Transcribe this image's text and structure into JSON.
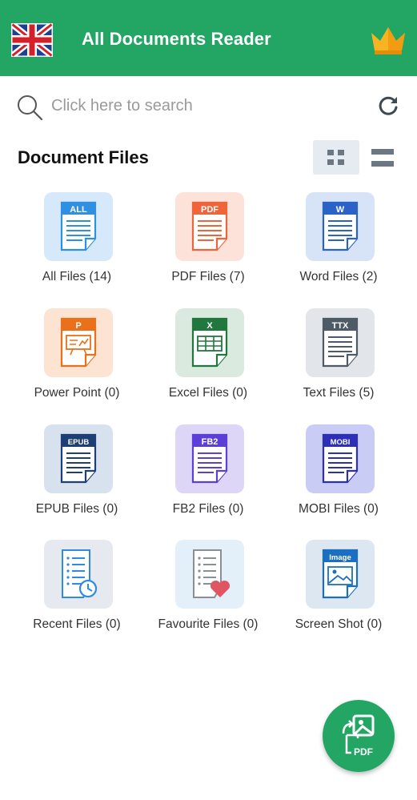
{
  "header": {
    "title": "All Documents Reader",
    "flag_icon": "uk-flag-icon",
    "premium_icon": "crown-icon",
    "color": "#23a564"
  },
  "search": {
    "placeholder": "Click here to search",
    "value": "",
    "refresh_icon": "refresh-icon"
  },
  "section": {
    "title": "Document Files",
    "view_modes": [
      "grid",
      "list"
    ],
    "active_view": "grid"
  },
  "tiles": [
    {
      "label": "All Files (14)",
      "badge": "ALL",
      "icon": "all-files-icon",
      "accent": "#2f8fe0",
      "bg": "#d6e9fb"
    },
    {
      "label": "PDF Files (7)",
      "badge": "PDF",
      "icon": "pdf-icon",
      "accent": "#f0643a",
      "bg": "#fde2da"
    },
    {
      "label": "Word Files (2)",
      "badge": "W",
      "icon": "word-icon",
      "accent": "#2a62c8",
      "bg": "#d7e4f7"
    },
    {
      "label": "Power Point (0)",
      "badge": "P",
      "icon": "powerpoint-icon",
      "accent": "#ea7019",
      "bg": "#fde3d2"
    },
    {
      "label": "Excel Files (0)",
      "badge": "X",
      "icon": "excel-icon",
      "accent": "#21783e",
      "bg": "#dbeadf"
    },
    {
      "label": "Text Files (5)",
      "badge": "TTX",
      "icon": "text-file-icon",
      "accent": "#4f5a67",
      "bg": "#e2e5ea"
    },
    {
      "label": "EPUB Files (0)",
      "badge": "EPUB",
      "icon": "epub-icon",
      "accent": "#1e3f73",
      "bg": "#d8e2ef"
    },
    {
      "label": "FB2 Files (0)",
      "badge": "FB2",
      "icon": "fb2-icon",
      "accent": "#5b3fd6",
      "bg": "#ddd6f6"
    },
    {
      "label": "MOBI Files (0)",
      "badge": "MOBI",
      "icon": "mobi-icon",
      "accent": "#2d2fb6",
      "bg": "#c9cdf5"
    },
    {
      "label": "Recent Files (0)",
      "badge": "",
      "icon": "recent-files-icon",
      "accent": "#2d8be3",
      "bg": "#e6e9ef"
    },
    {
      "label": "Favourite Files (0)",
      "badge": "",
      "icon": "favourite-files-icon",
      "accent": "#e05561",
      "bg": "#e3f0fa"
    },
    {
      "label": "Screen Shot (0)",
      "badge": "Image",
      "icon": "screenshot-icon",
      "accent": "#1b6fc2",
      "bg": "#dde7f2"
    }
  ],
  "fab": {
    "label": "PDF",
    "icon": "image-to-pdf-icon"
  }
}
